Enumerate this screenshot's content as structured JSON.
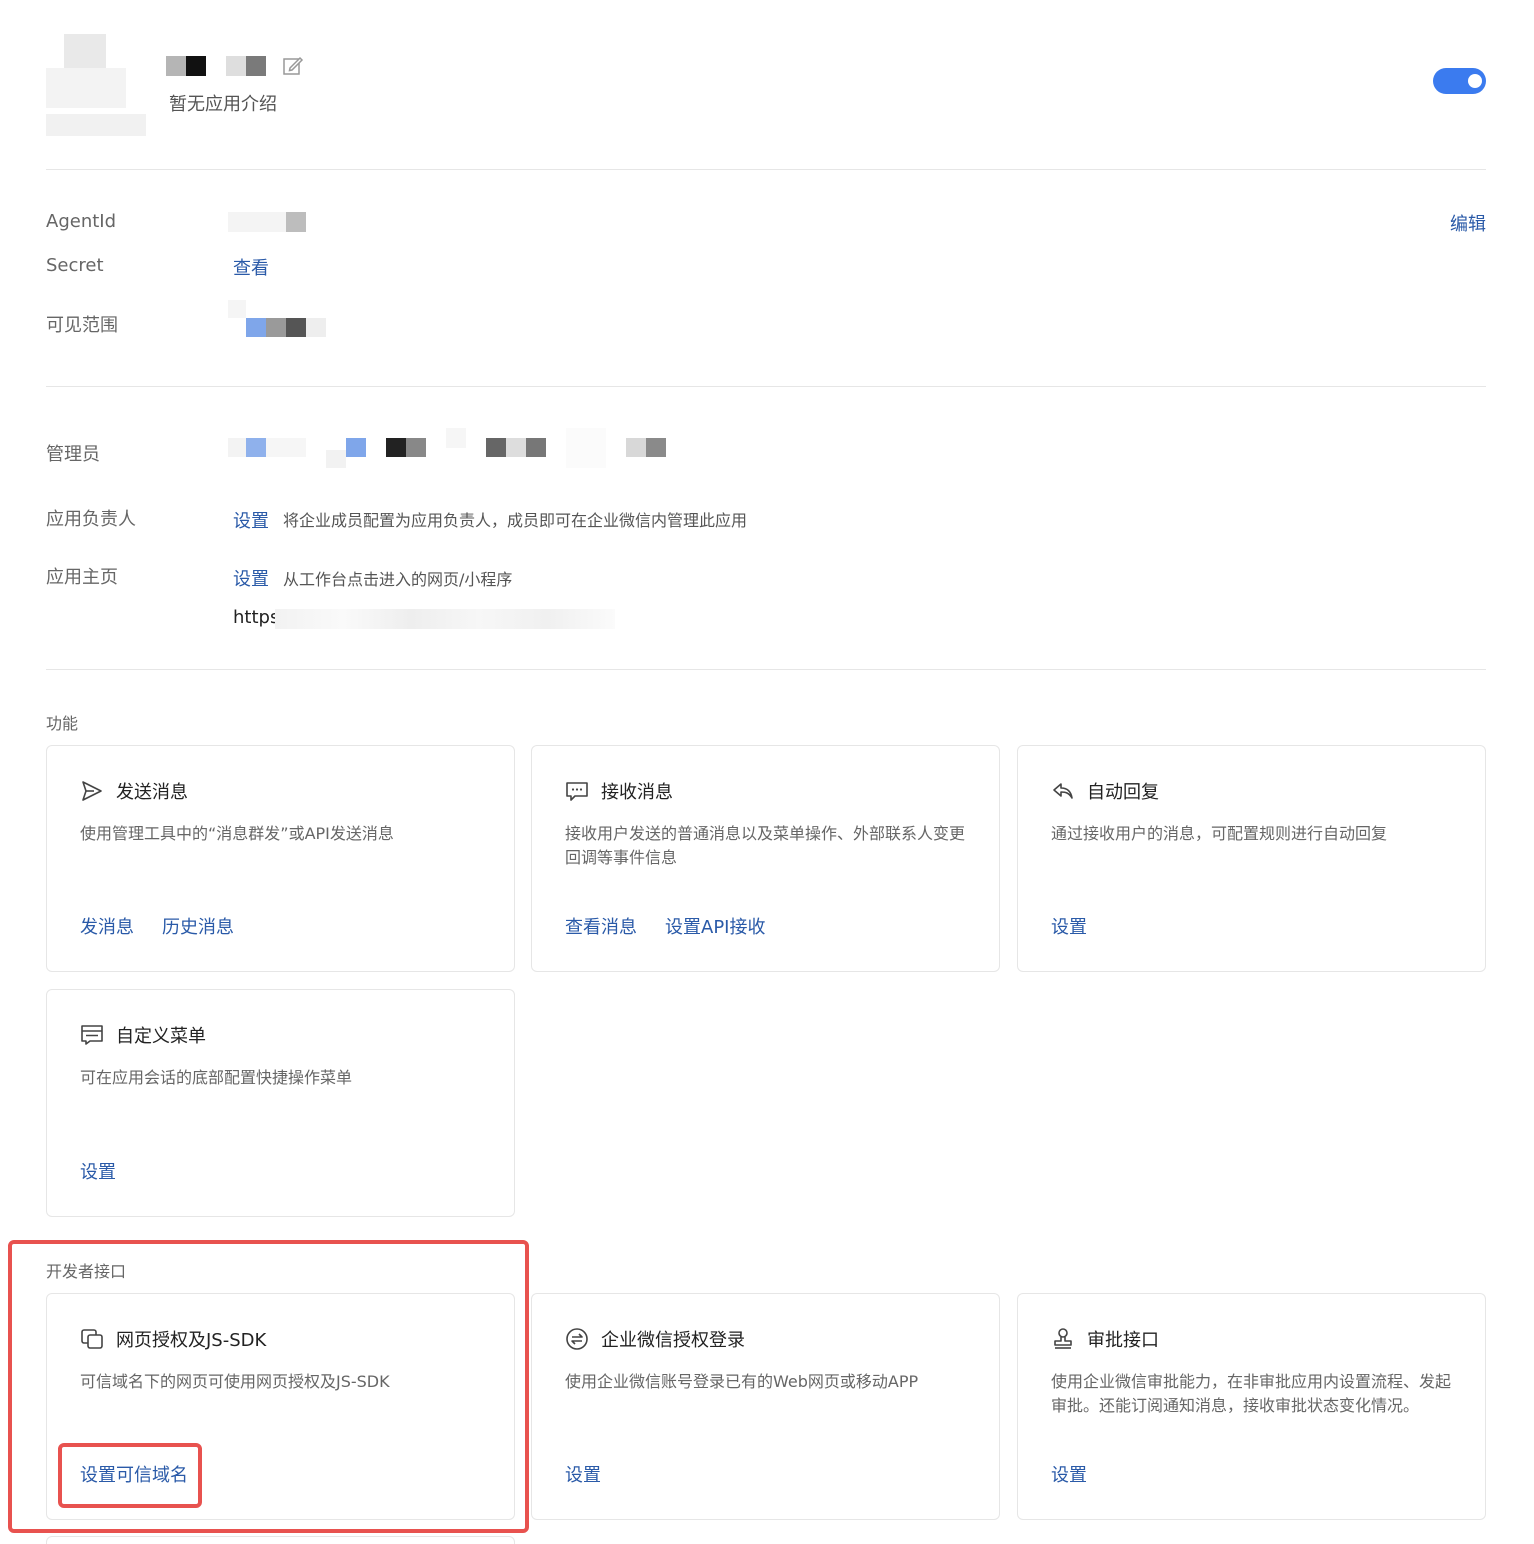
{
  "header": {
    "app_description": "暂无应用介绍",
    "toggle_on": true
  },
  "info": {
    "agentid_label": "AgentId",
    "secret_label": "Secret",
    "secret_view": "查看",
    "scope_label": "可见范围",
    "edit_link": "编辑"
  },
  "admin": {
    "admin_label": "管理员",
    "owner_label": "应用负责人",
    "owner_set": "设置",
    "owner_desc": "将企业成员配置为应用负责人，成员即可在企业微信内管理此应用",
    "homepage_label": "应用主页",
    "homepage_set": "设置",
    "homepage_desc": "从工作台点击进入的网页/小程序",
    "homepage_url_prefix": "https:"
  },
  "features": {
    "section_title": "功能",
    "cards": [
      {
        "title": "发送消息",
        "icon": "send-icon",
        "desc": "使用管理工具中的“消息群发”或API发送消息",
        "actions": [
          "发消息",
          "历史消息"
        ]
      },
      {
        "title": "接收消息",
        "icon": "chat-bubble-icon",
        "desc": "接收用户发送的普通消息以及菜单操作、外部联系人变更回调等事件信息",
        "actions": [
          "查看消息",
          "设置API接收"
        ]
      },
      {
        "title": "自动回复",
        "icon": "reply-icon",
        "desc": "通过接收用户的消息，可配置规则进行自动回复",
        "actions": [
          "设置"
        ]
      },
      {
        "title": "自定义菜单",
        "icon": "menu-icon",
        "desc": "可在应用会话的底部配置快捷操作菜单",
        "actions": [
          "设置"
        ]
      }
    ]
  },
  "developer": {
    "section_title": "开发者接口",
    "cards": [
      {
        "title": "网页授权及JS-SDK",
        "icon": "copy-window-icon",
        "desc": "可信域名下的网页可使用网页授权及JS-SDK",
        "actions": [
          "设置可信域名"
        ]
      },
      {
        "title": "企业微信授权登录",
        "icon": "exchange-icon",
        "desc": "使用企业微信账号登录已有的Web网页或移动APP",
        "actions": [
          "设置"
        ]
      },
      {
        "title": "审批接口",
        "icon": "stamp-icon",
        "desc": "使用企业微信审批能力，在非审批应用内设置流程、发起审批。还能订阅通知消息，接收审批状态变化情况。",
        "actions": [
          "设置"
        ]
      }
    ]
  },
  "colors": {
    "link": "#2a5aa8",
    "toggle": "#3b7bef",
    "highlight": "#e8524f"
  }
}
